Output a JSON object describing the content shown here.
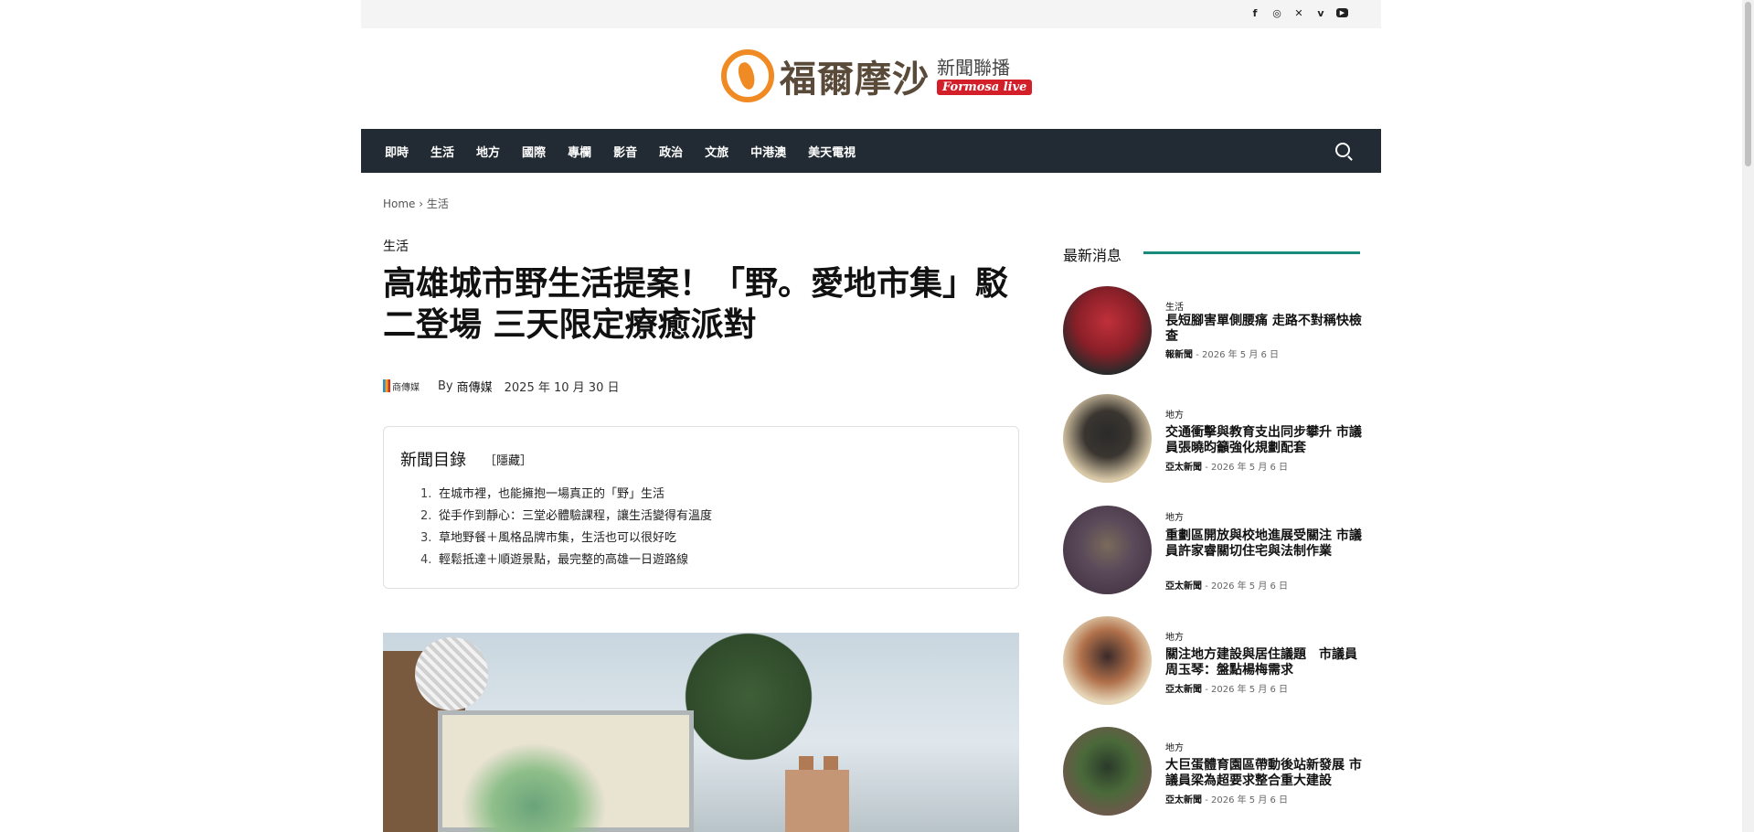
{
  "social": [
    "f",
    "ig",
    "x",
    "v",
    "yt"
  ],
  "logo": {
    "main": "福爾摩沙",
    "sub": "新聞聯播",
    "tag": "Formosa live"
  },
  "nav": {
    "items": [
      "即時",
      "生活",
      "地方",
      "國際",
      "專欄",
      "影音",
      "政治",
      "文旅",
      "中港澳",
      "美天電視"
    ]
  },
  "breadcrumb": {
    "home": "Home",
    "sep": "›",
    "current": "生活"
  },
  "article": {
    "category": "生活",
    "title": "高雄城市野生活提案！「野。愛地市集」駁二登場 三天限定療癒派對",
    "author_logo": "商傳媒",
    "by": "By",
    "author": "商傳媒",
    "date": "2025 年 10 月 30 日"
  },
  "toc": {
    "title": "新聞目錄",
    "toggle": "［隱藏］",
    "items": [
      {
        "n": "1.",
        "text": "在城市裡，也能擁抱一場真正的「野」生活"
      },
      {
        "n": "2.",
        "text": "從手作到靜心：三堂必體驗課程，讓生活變得有溫度"
      },
      {
        "n": "3.",
        "text": "草地野餐＋風格品牌市集，生活也可以很好吃"
      },
      {
        "n": "4.",
        "text": "輕鬆抵達＋順遊景點，最完整的高雄一日遊路線"
      }
    ]
  },
  "sidebar": {
    "title": "最新消息",
    "items": [
      {
        "cat": "生活",
        "headline": "長短腳害單側腰痛 走路不對稱快檢查",
        "source": "報新聞",
        "sep": "-",
        "date": "2026 年 5 月 6 日"
      },
      {
        "cat": "地方",
        "headline": "交通衝擊與教育支出同步攀升 市議員張曉昀籲強化規劃配套",
        "source": "亞太新聞",
        "sep": "-",
        "date": "2026 年 5 月 6 日"
      },
      {
        "cat": "地方",
        "headline": "重劃區開放與校地進展受關注 市議員許家睿關切住宅與法制作業",
        "source": "亞太新聞",
        "sep": "-",
        "date": "2026 年 5 月 6 日"
      },
      {
        "cat": "地方",
        "headline": "關注地方建設與居住議題　市議員周玉琴：盤點楊梅需求",
        "source": "亞太新聞",
        "sep": "-",
        "date": "2026 年 5 月 6 日"
      },
      {
        "cat": "地方",
        "headline": "大巨蛋體育園區帶動後站新發展 市議員梁為超要求整合重大建設",
        "source": "亞太新聞",
        "sep": "-",
        "date": "2026 年 5 月 6 日"
      }
    ]
  },
  "colors": {
    "nav_bg": "#222b33",
    "accent": "#1a8a7c",
    "logo_orange": "#f08a24",
    "logo_red": "#d21f2a"
  }
}
